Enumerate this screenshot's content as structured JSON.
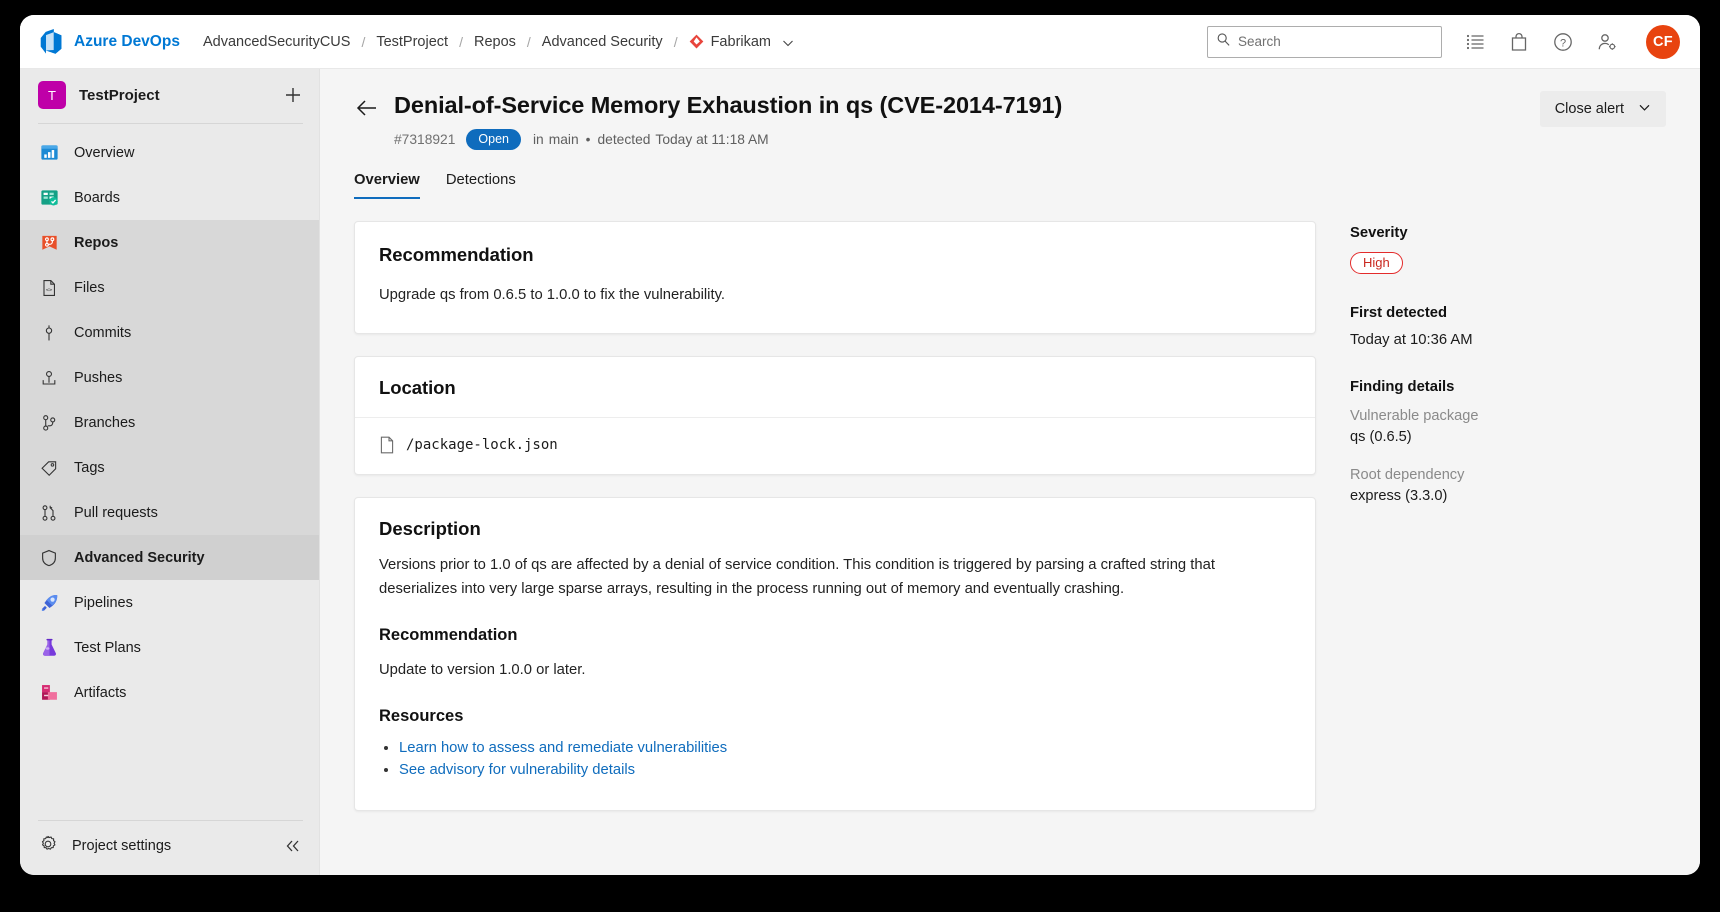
{
  "topbar": {
    "brand": "Azure DevOps",
    "logo_icon": "azure-devops-logo",
    "breadcrumbs": [
      {
        "label": "AdvancedSecurityCUS"
      },
      {
        "label": "TestProject"
      },
      {
        "label": "Repos"
      },
      {
        "label": "Advanced Security"
      }
    ],
    "separator": "/",
    "org": {
      "label": "Fabrikam",
      "icon": "fabrikam-diamond-icon",
      "chevron": "chevron-down-icon"
    },
    "search": {
      "placeholder": "Search",
      "value": "",
      "icon": "search-icon"
    },
    "icons": [
      {
        "name": "backlog-list-icon"
      },
      {
        "name": "marketplace-bag-icon"
      },
      {
        "name": "help-question-icon"
      },
      {
        "name": "user-settings-icon"
      }
    ],
    "avatar": {
      "initials": "CF",
      "color": "#e8430f"
    }
  },
  "sidebar": {
    "project": {
      "initial": "T",
      "name": "TestProject",
      "color": "#bf00a8"
    },
    "add_icon": "plus-icon",
    "items": [
      {
        "label": "Overview",
        "icon": "overview-icon",
        "active": false
      },
      {
        "label": "Boards",
        "icon": "boards-icon",
        "active": false
      },
      {
        "label": "Repos",
        "icon": "repos-icon",
        "active": false,
        "section": true
      },
      {
        "label": "Files",
        "icon": "file-code-icon",
        "active": false
      },
      {
        "label": "Commits",
        "icon": "commit-icon",
        "active": false
      },
      {
        "label": "Pushes",
        "icon": "push-icon",
        "active": false
      },
      {
        "label": "Branches",
        "icon": "branch-icon",
        "active": false
      },
      {
        "label": "Tags",
        "icon": "tag-icon",
        "active": false
      },
      {
        "label": "Pull requests",
        "icon": "pull-request-icon",
        "active": false
      },
      {
        "label": "Advanced Security",
        "icon": "shield-icon",
        "active": true
      },
      {
        "label": "Pipelines",
        "icon": "pipelines-icon",
        "active": false
      },
      {
        "label": "Test Plans",
        "icon": "test-plans-icon",
        "active": false
      },
      {
        "label": "Artifacts",
        "icon": "artifacts-icon",
        "active": false
      }
    ],
    "footer": {
      "label": "Project settings",
      "icon": "gear-icon",
      "collapse_icon": "double-chevron-left-icon"
    }
  },
  "alert": {
    "back_icon": "arrow-left-icon",
    "title": "Denial-of-Service Memory Exhaustion in qs (CVE-2014-7191)",
    "id": "#7318921",
    "state": "Open",
    "state_color": "#0f6cbd",
    "branch_prefix": "in",
    "branch": "main",
    "separator": "•",
    "detected_prefix": "detected",
    "detected_at": "Today at 11:18 AM",
    "close_button": {
      "label": "Close alert",
      "chevron": "chevron-down-icon"
    },
    "tabs": [
      {
        "label": "Overview",
        "active": true
      },
      {
        "label": "Detections",
        "active": false
      }
    ]
  },
  "cards": {
    "recommendation": {
      "title": "Recommendation",
      "text": "Upgrade qs from 0.6.5 to 1.0.0 to fix the vulnerability."
    },
    "location": {
      "title": "Location",
      "file_icon": "file-icon",
      "path": "/package-lock.json"
    },
    "description": {
      "title": "Description",
      "body": "Versions prior to 1.0 of qs are affected by a denial of service condition. This condition is triggered by parsing a crafted string that deserializes into very large sparse arrays, resulting in the process running out of memory and eventually crashing.",
      "recommendation_title": "Recommendation",
      "recommendation_text": "Update to version 1.0.0 or later.",
      "resources_title": "Resources",
      "resources": [
        {
          "label": "Learn how to assess and remediate vulnerabilities"
        },
        {
          "label": "See advisory for vulnerability details"
        }
      ]
    }
  },
  "right_panel": {
    "severity_label": "Severity",
    "severity_value": "High",
    "severity_color": "#c9281f",
    "first_detected_label": "First detected",
    "first_detected_value": "Today at 10:36 AM",
    "finding_details_label": "Finding details",
    "details": [
      {
        "label": "Vulnerable package",
        "value": "qs (0.6.5)"
      },
      {
        "label": "Root dependency",
        "value": "express (3.3.0)"
      }
    ]
  }
}
